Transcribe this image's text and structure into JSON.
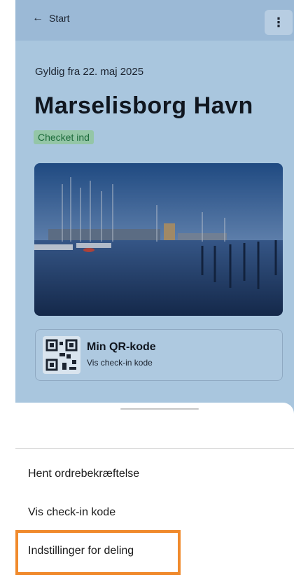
{
  "topbar": {
    "back_label": "Start",
    "back_icon": "arrow-left-icon",
    "menu_icon": "more-vertical-icon",
    "menu_glyph": "⋮"
  },
  "ticket": {
    "valid_from": "Gyldig fra 22. maj 2025",
    "title": "Marselisborg Havn",
    "status_badge": "Checket ind"
  },
  "qr_card": {
    "title": "Min QR-kode",
    "subtitle": "Vis check-in kode"
  },
  "sheet": {
    "items": [
      {
        "label": "Hent ordrebekræftelse"
      },
      {
        "label": "Vis check-in kode"
      },
      {
        "label": "Indstillinger for deling"
      }
    ],
    "highlight_color": "#f08a2c"
  },
  "colors": {
    "overlay_page": "#a9c6de",
    "badge_bg": "#94c6a7",
    "badge_text": "#1c6a3a"
  }
}
